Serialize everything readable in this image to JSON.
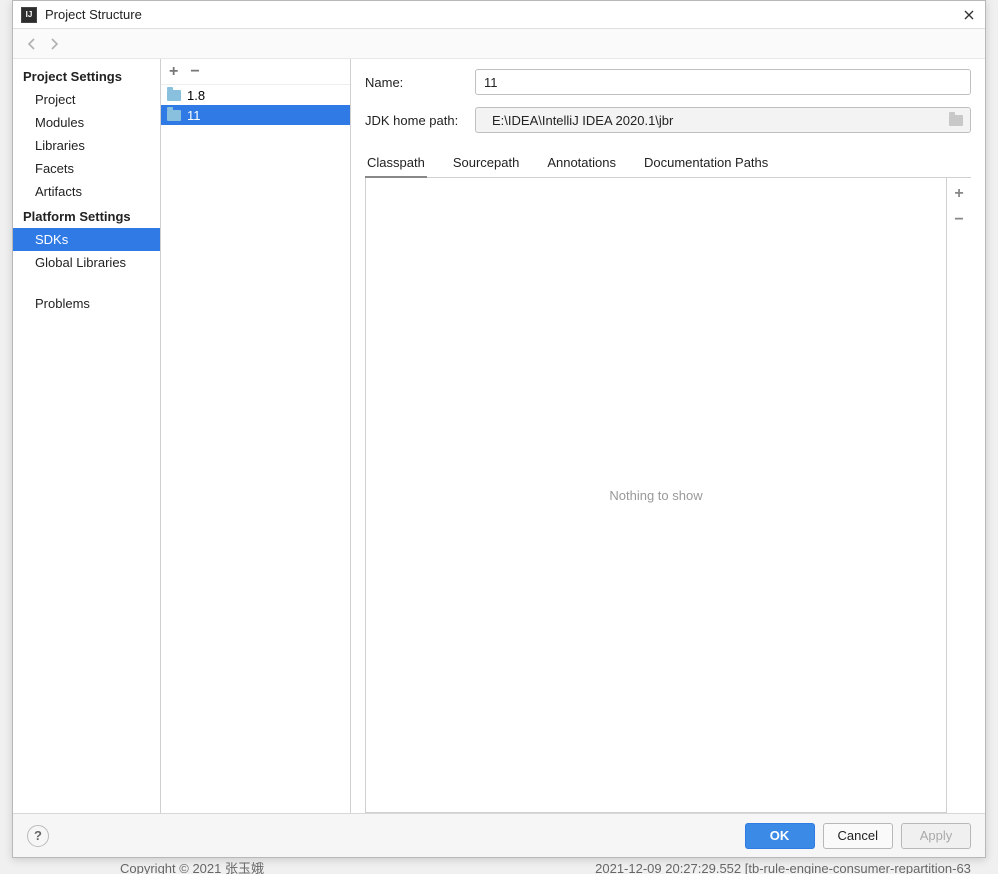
{
  "window": {
    "title": "Project Structure"
  },
  "sidebar": {
    "section_project": "Project Settings",
    "items_project": [
      {
        "label": "Project"
      },
      {
        "label": "Modules"
      },
      {
        "label": "Libraries"
      },
      {
        "label": "Facets"
      },
      {
        "label": "Artifacts"
      }
    ],
    "section_platform": "Platform Settings",
    "items_platform": [
      {
        "label": "SDKs",
        "selected": true
      },
      {
        "label": "Global Libraries"
      }
    ],
    "item_problems": "Problems"
  },
  "sdkList": {
    "entries": [
      {
        "label": "1.8",
        "selected": false
      },
      {
        "label": "11",
        "selected": true
      }
    ]
  },
  "form": {
    "name_label": "Name:",
    "name_value": "11",
    "path_label": "JDK home path:",
    "path_value": "E:\\IDEA\\IntelliJ IDEA 2020.1\\jbr"
  },
  "tabs": {
    "items": [
      {
        "label": "Classpath",
        "active": true
      },
      {
        "label": "Sourcepath"
      },
      {
        "label": "Annotations"
      },
      {
        "label": "Documentation Paths"
      }
    ]
  },
  "classpath": {
    "empty_text": "Nothing to show"
  },
  "footer": {
    "ok": "OK",
    "cancel": "Cancel",
    "apply": "Apply"
  },
  "background": {
    "copyright": "Copyright © 2021 张玉娥",
    "log": "2021-12-09 20:27:29.552 [tb-rule-engine-consumer-repartition-63"
  }
}
